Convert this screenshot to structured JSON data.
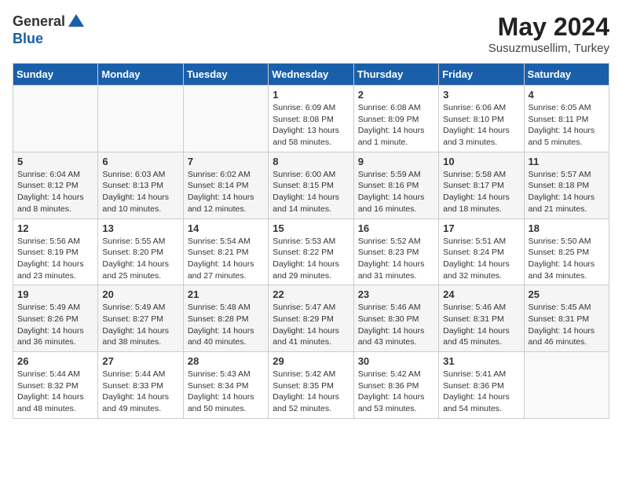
{
  "header": {
    "logo_general": "General",
    "logo_blue": "Blue",
    "month_title": "May 2024",
    "location": "Susuzmusellim, Turkey"
  },
  "weekdays": [
    "Sunday",
    "Monday",
    "Tuesday",
    "Wednesday",
    "Thursday",
    "Friday",
    "Saturday"
  ],
  "weeks": [
    [
      {
        "day": "",
        "sunrise": "",
        "sunset": "",
        "daylight": ""
      },
      {
        "day": "",
        "sunrise": "",
        "sunset": "",
        "daylight": ""
      },
      {
        "day": "",
        "sunrise": "",
        "sunset": "",
        "daylight": ""
      },
      {
        "day": "1",
        "sunrise": "Sunrise: 6:09 AM",
        "sunset": "Sunset: 8:08 PM",
        "daylight": "Daylight: 13 hours and 58 minutes."
      },
      {
        "day": "2",
        "sunrise": "Sunrise: 6:08 AM",
        "sunset": "Sunset: 8:09 PM",
        "daylight": "Daylight: 14 hours and 1 minute."
      },
      {
        "day": "3",
        "sunrise": "Sunrise: 6:06 AM",
        "sunset": "Sunset: 8:10 PM",
        "daylight": "Daylight: 14 hours and 3 minutes."
      },
      {
        "day": "4",
        "sunrise": "Sunrise: 6:05 AM",
        "sunset": "Sunset: 8:11 PM",
        "daylight": "Daylight: 14 hours and 5 minutes."
      }
    ],
    [
      {
        "day": "5",
        "sunrise": "Sunrise: 6:04 AM",
        "sunset": "Sunset: 8:12 PM",
        "daylight": "Daylight: 14 hours and 8 minutes."
      },
      {
        "day": "6",
        "sunrise": "Sunrise: 6:03 AM",
        "sunset": "Sunset: 8:13 PM",
        "daylight": "Daylight: 14 hours and 10 minutes."
      },
      {
        "day": "7",
        "sunrise": "Sunrise: 6:02 AM",
        "sunset": "Sunset: 8:14 PM",
        "daylight": "Daylight: 14 hours and 12 minutes."
      },
      {
        "day": "8",
        "sunrise": "Sunrise: 6:00 AM",
        "sunset": "Sunset: 8:15 PM",
        "daylight": "Daylight: 14 hours and 14 minutes."
      },
      {
        "day": "9",
        "sunrise": "Sunrise: 5:59 AM",
        "sunset": "Sunset: 8:16 PM",
        "daylight": "Daylight: 14 hours and 16 minutes."
      },
      {
        "day": "10",
        "sunrise": "Sunrise: 5:58 AM",
        "sunset": "Sunset: 8:17 PM",
        "daylight": "Daylight: 14 hours and 18 minutes."
      },
      {
        "day": "11",
        "sunrise": "Sunrise: 5:57 AM",
        "sunset": "Sunset: 8:18 PM",
        "daylight": "Daylight: 14 hours and 21 minutes."
      }
    ],
    [
      {
        "day": "12",
        "sunrise": "Sunrise: 5:56 AM",
        "sunset": "Sunset: 8:19 PM",
        "daylight": "Daylight: 14 hours and 23 minutes."
      },
      {
        "day": "13",
        "sunrise": "Sunrise: 5:55 AM",
        "sunset": "Sunset: 8:20 PM",
        "daylight": "Daylight: 14 hours and 25 minutes."
      },
      {
        "day": "14",
        "sunrise": "Sunrise: 5:54 AM",
        "sunset": "Sunset: 8:21 PM",
        "daylight": "Daylight: 14 hours and 27 minutes."
      },
      {
        "day": "15",
        "sunrise": "Sunrise: 5:53 AM",
        "sunset": "Sunset: 8:22 PM",
        "daylight": "Daylight: 14 hours and 29 minutes."
      },
      {
        "day": "16",
        "sunrise": "Sunrise: 5:52 AM",
        "sunset": "Sunset: 8:23 PM",
        "daylight": "Daylight: 14 hours and 31 minutes."
      },
      {
        "day": "17",
        "sunrise": "Sunrise: 5:51 AM",
        "sunset": "Sunset: 8:24 PM",
        "daylight": "Daylight: 14 hours and 32 minutes."
      },
      {
        "day": "18",
        "sunrise": "Sunrise: 5:50 AM",
        "sunset": "Sunset: 8:25 PM",
        "daylight": "Daylight: 14 hours and 34 minutes."
      }
    ],
    [
      {
        "day": "19",
        "sunrise": "Sunrise: 5:49 AM",
        "sunset": "Sunset: 8:26 PM",
        "daylight": "Daylight: 14 hours and 36 minutes."
      },
      {
        "day": "20",
        "sunrise": "Sunrise: 5:49 AM",
        "sunset": "Sunset: 8:27 PM",
        "daylight": "Daylight: 14 hours and 38 minutes."
      },
      {
        "day": "21",
        "sunrise": "Sunrise: 5:48 AM",
        "sunset": "Sunset: 8:28 PM",
        "daylight": "Daylight: 14 hours and 40 minutes."
      },
      {
        "day": "22",
        "sunrise": "Sunrise: 5:47 AM",
        "sunset": "Sunset: 8:29 PM",
        "daylight": "Daylight: 14 hours and 41 minutes."
      },
      {
        "day": "23",
        "sunrise": "Sunrise: 5:46 AM",
        "sunset": "Sunset: 8:30 PM",
        "daylight": "Daylight: 14 hours and 43 minutes."
      },
      {
        "day": "24",
        "sunrise": "Sunrise: 5:46 AM",
        "sunset": "Sunset: 8:31 PM",
        "daylight": "Daylight: 14 hours and 45 minutes."
      },
      {
        "day": "25",
        "sunrise": "Sunrise: 5:45 AM",
        "sunset": "Sunset: 8:31 PM",
        "daylight": "Daylight: 14 hours and 46 minutes."
      }
    ],
    [
      {
        "day": "26",
        "sunrise": "Sunrise: 5:44 AM",
        "sunset": "Sunset: 8:32 PM",
        "daylight": "Daylight: 14 hours and 48 minutes."
      },
      {
        "day": "27",
        "sunrise": "Sunrise: 5:44 AM",
        "sunset": "Sunset: 8:33 PM",
        "daylight": "Daylight: 14 hours and 49 minutes."
      },
      {
        "day": "28",
        "sunrise": "Sunrise: 5:43 AM",
        "sunset": "Sunset: 8:34 PM",
        "daylight": "Daylight: 14 hours and 50 minutes."
      },
      {
        "day": "29",
        "sunrise": "Sunrise: 5:42 AM",
        "sunset": "Sunset: 8:35 PM",
        "daylight": "Daylight: 14 hours and 52 minutes."
      },
      {
        "day": "30",
        "sunrise": "Sunrise: 5:42 AM",
        "sunset": "Sunset: 8:36 PM",
        "daylight": "Daylight: 14 hours and 53 minutes."
      },
      {
        "day": "31",
        "sunrise": "Sunrise: 5:41 AM",
        "sunset": "Sunset: 8:36 PM",
        "daylight": "Daylight: 14 hours and 54 minutes."
      },
      {
        "day": "",
        "sunrise": "",
        "sunset": "",
        "daylight": ""
      }
    ]
  ]
}
